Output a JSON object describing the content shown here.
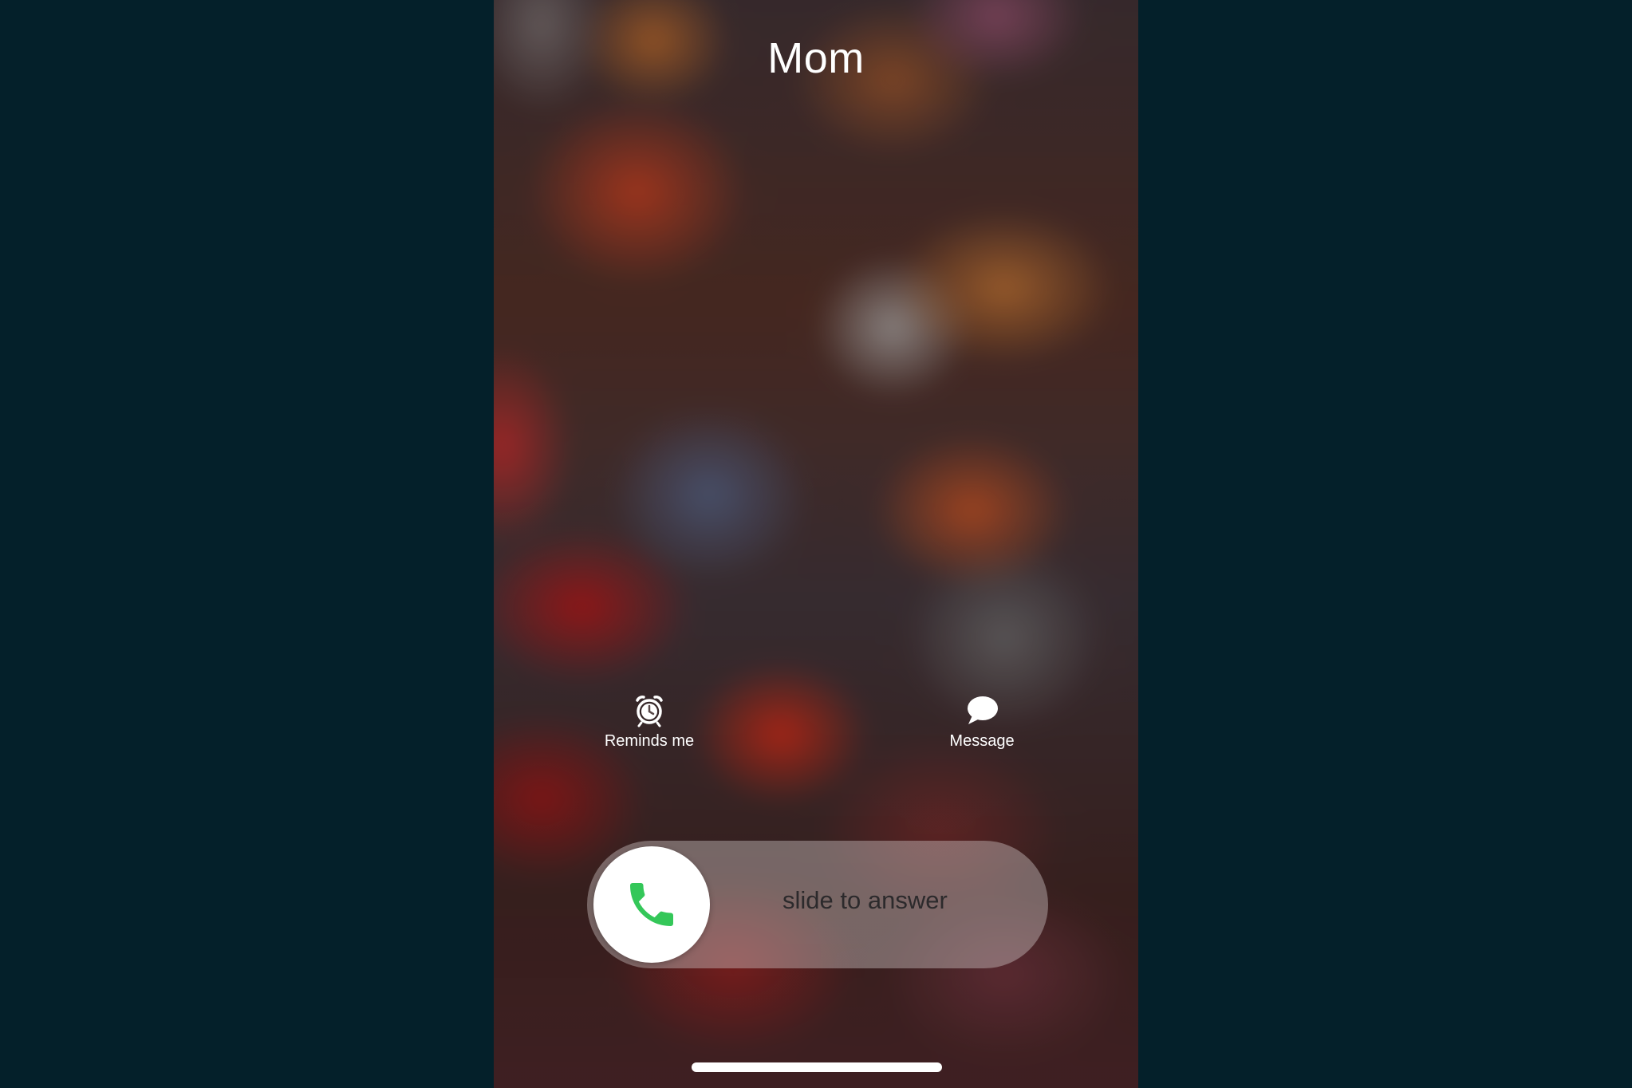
{
  "caller": {
    "name": "Mom"
  },
  "actions": {
    "remind": {
      "label": "Reminds me",
      "icon": "alarm-clock-icon"
    },
    "message": {
      "label": "Message",
      "icon": "speech-bubble-icon"
    }
  },
  "slider": {
    "label": "slide to answer",
    "icon": "phone-icon",
    "knob_color": "#ffffff",
    "icon_color": "#34c759"
  },
  "colors": {
    "background": "#04202a",
    "text": "#ffffff"
  }
}
